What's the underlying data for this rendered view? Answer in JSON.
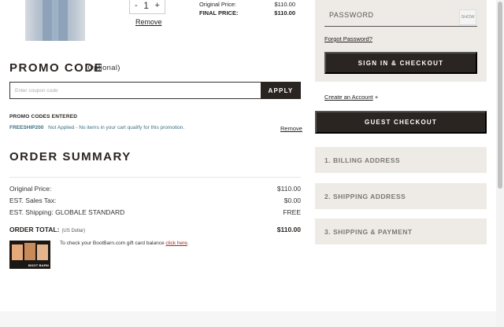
{
  "cart_item": {
    "quantity": "1",
    "minus": "-",
    "plus": "+",
    "remove_label": "Remove",
    "original_price_label": "Original Price:",
    "original_price": "$110.00",
    "final_price_label": "FINAL PRICE:",
    "final_price": "$110.00"
  },
  "promo": {
    "title": "PROMO CODE",
    "optional": "(Optional)",
    "input_placeholder": "Enter coupon code",
    "apply_label": "APPLY",
    "entered_title": "PROMO CODES ENTERED",
    "code": "FREESHIP200",
    "code_status": "Not Applied - No items in your cart qualify for this promotion.",
    "remove_label": "Remove"
  },
  "summary": {
    "title": "ORDER SUMMARY",
    "rows": [
      {
        "label": "Original Price:",
        "value": "$110.00"
      },
      {
        "label": "EST. Sales Tax:",
        "value": "$0.00"
      },
      {
        "label": "EST. Shipping: GLOBALE STANDARD",
        "value": "FREE"
      }
    ],
    "total_label": "ORDER TOTAL:",
    "total_currency": "(US Dollar)",
    "total_value": "$110.00",
    "gift_text": "To check your BootBarn.com gift card balance",
    "gift_link": "click here",
    "gift_period": ".",
    "gift_logo": "BOOT BARN"
  },
  "login": {
    "password_placeholder": "PASSWORD",
    "show_label": "SHOW",
    "forgot_label": "Forgot Password?",
    "signin_label": "SIGN IN & CHECKOUT",
    "create_account_label": "Create an Account",
    "create_plus": "+",
    "guest_label": "GUEST CHECKOUT"
  },
  "steps": [
    {
      "label": "1. BILLING ADDRESS"
    },
    {
      "label": "2. SHIPPING ADDRESS"
    },
    {
      "label": "3. SHIPPING & PAYMENT"
    }
  ]
}
